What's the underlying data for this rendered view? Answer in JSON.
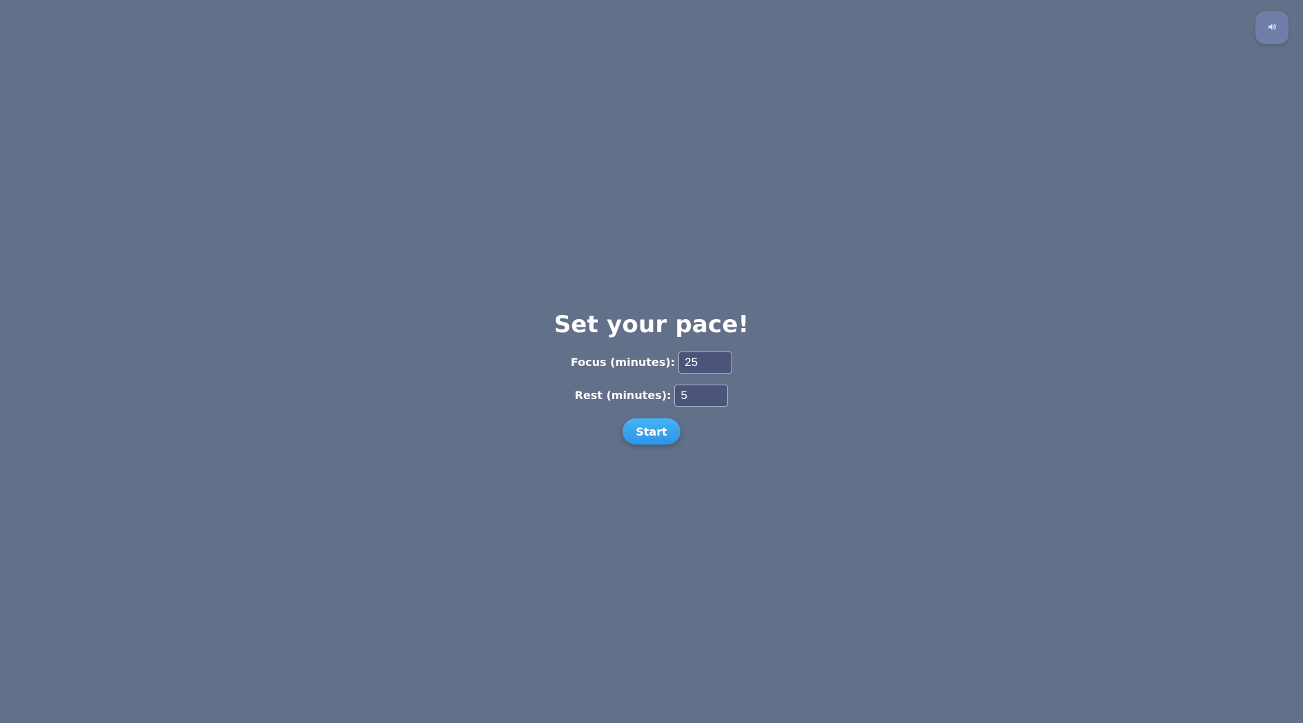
{
  "title": "Set your pace!",
  "sound": {
    "icon": "speaker-icon"
  },
  "form": {
    "focus": {
      "label": "Focus (minutes):",
      "value": "25"
    },
    "rest": {
      "label": "Rest (minutes):",
      "value": "5"
    },
    "start_label": "Start"
  },
  "colors": {
    "background": "#637089",
    "accent": "#2a95e8",
    "input_bg": "#4c5579"
  }
}
